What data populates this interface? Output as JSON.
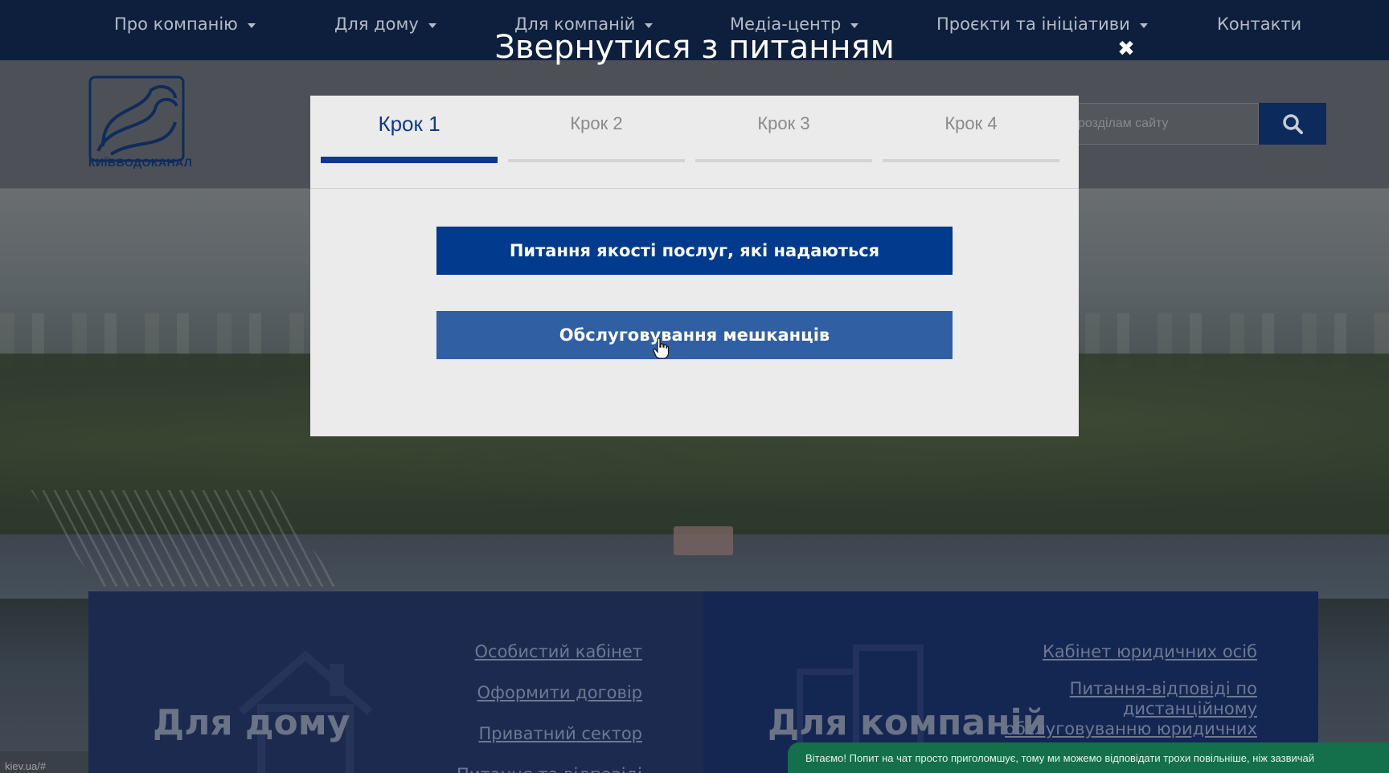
{
  "nav": {
    "items": [
      {
        "label": "Про компанію",
        "dropdown": true
      },
      {
        "label": "Для дому",
        "dropdown": true
      },
      {
        "label": "Для компаній",
        "dropdown": true
      },
      {
        "label": "Медіа-центр",
        "dropdown": true
      },
      {
        "label": "Проєкти та ініціативи",
        "dropdown": true
      },
      {
        "label": "Контакти",
        "dropdown": false
      }
    ]
  },
  "header": {
    "logo_text": "КИЇВВОДОКАНАЛ",
    "search_placeholder": "розділам сайту",
    "search_icon": "search-icon"
  },
  "panels": {
    "home": {
      "title": "Для дому",
      "links": [
        "Особистий кабінет",
        "Оформити договір",
        "Приватний сектор",
        "Питання та відповіді"
      ]
    },
    "business": {
      "title": "Для компаній",
      "links": [
        "Кабінет юридичних осіб",
        "Питання-відповіді по",
        "дистанційному",
        "обслуговуванню юридичних"
      ]
    }
  },
  "modal": {
    "title": "Звернутися з питанням",
    "close_icon": "close-icon",
    "steps": [
      {
        "label": "Крок 1",
        "active": true
      },
      {
        "label": "Крок 2",
        "active": false
      },
      {
        "label": "Крок 3",
        "active": false
      },
      {
        "label": "Крок 4",
        "active": false
      }
    ],
    "options": [
      "Питання якості послуг, які надаються",
      "Обслуговування мешканців"
    ]
  },
  "status_url": "kiev.ua/#",
  "chat_banner": "Вітаємо! Попит на чат просто приголомшує, тому ми можемо відповідати трохи повільніше, ніж зазвичай",
  "colors": {
    "nav_bg": "#0d1f3d",
    "accent": "#0e3a87",
    "option_primary": "#023a8d",
    "option_secondary": "#315fa4",
    "chat_green": "#13704a"
  }
}
